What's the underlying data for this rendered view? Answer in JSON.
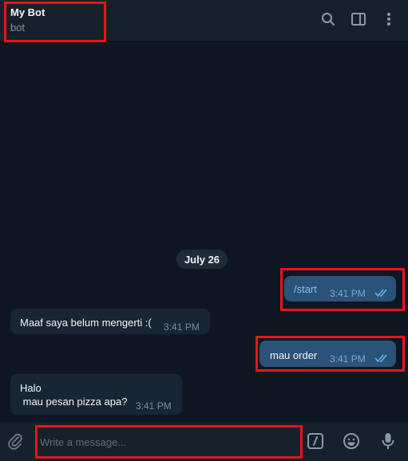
{
  "header": {
    "title": "My Bot",
    "subtitle": "bot",
    "icons": [
      "search-icon",
      "sidebar-toggle-icon",
      "more-vert-icon"
    ]
  },
  "chat": {
    "date_chip": "July 26",
    "messages": [
      {
        "direction": "outgoing",
        "text": "/start",
        "time": "3:41 PM",
        "status": "read"
      },
      {
        "direction": "incoming",
        "text": "Maaf saya belum mengerti :(",
        "time": "3:41 PM"
      },
      {
        "direction": "outgoing",
        "text": "mau order",
        "time": "3:41 PM",
        "status": "read"
      },
      {
        "direction": "incoming",
        "lines": [
          "Halo",
          " mau pesan pizza apa?"
        ],
        "time": "3:41 PM"
      }
    ]
  },
  "composer": {
    "placeholder": "Write a message...",
    "icons": [
      "paperclip-icon",
      "bot-commands-icon",
      "emoji-icon",
      "microphone-icon"
    ]
  },
  "colors": {
    "background": "#0e1621",
    "header": "#17212b",
    "outgoing_bubble": "#2b5278",
    "incoming_bubble": "#182533",
    "highlight": "#e8141b",
    "link": "#7ec4f8"
  }
}
